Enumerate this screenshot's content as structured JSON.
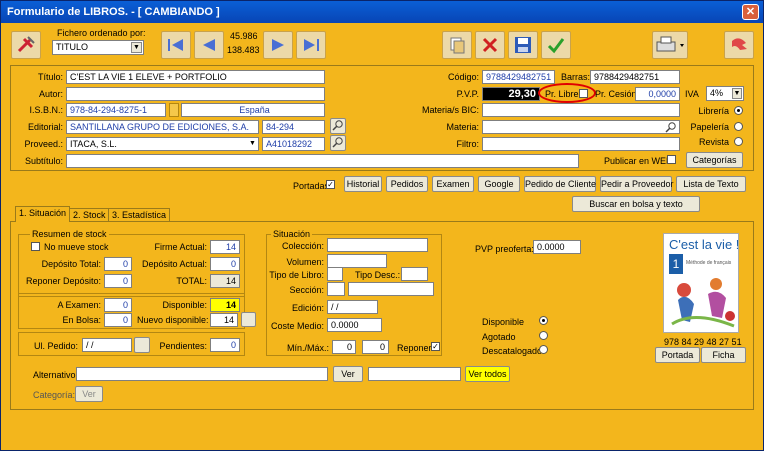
{
  "window": {
    "title": "Formulario de LIBROS. - [ CAMBIANDO ]",
    "close": "✕"
  },
  "toolbar": {
    "order_label": "Fichero ordenado por:",
    "order_value": "TITULO",
    "count_top": "45.986",
    "count_bottom": "138.483"
  },
  "book": {
    "titulo_label": "Título:",
    "titulo": "C'EST LA VIE 1 ELEVE + PORTFOLIO",
    "autor_label": "Autor:",
    "autor": "",
    "isbn_label": "I.S.B.N.:",
    "isbn": "978-84-294-8275-1",
    "pais": "España",
    "editorial_label": "Editorial:",
    "editorial": "SANTILLANA GRUPO DE EDICIONES, S.A.",
    "editorial_code": "84-294",
    "proveed_label": "Proveed.:",
    "proveed": "ITACA, S.L.",
    "proveed_code": "A41018292",
    "subtitulo_label": "Subtítulo:",
    "subtitulo": "",
    "codigo_label": "Código:",
    "codigo": "9788429482751",
    "barras_label": "Barras:",
    "barras": "9788429482751",
    "pvp_label": "P.V.P.",
    "pvp": "29,30",
    "pr_libre_label": "Pr. Libre",
    "pr_cesion_label": "Pr. Cesión",
    "pr_cesion": "0,0000",
    "iva_label": "IVA",
    "iva": "4%",
    "materia_bic_label": "Materia/s BIC:",
    "materia_label": "Materia:",
    "filtro_label": "Filtro:",
    "libreria_label": "Librería",
    "papeleria_label": "Papelería",
    "revista_label": "Revista",
    "publicar_web_label": "Publicar en WEB",
    "categorias_btn": "Categorías"
  },
  "actions": {
    "portadas_label": "Portadas",
    "buttons": [
      "Historial",
      "Pedidos",
      "Examen",
      "Google",
      "Pedido de Cliente",
      "Pedir a Proveedor",
      "Lista de Texto"
    ],
    "buscar_bolsa": "Buscar en bolsa y texto"
  },
  "tabs": [
    "1. Situación",
    "2. Stock",
    "3. Estadística"
  ],
  "stock": {
    "resumen_title": "Resumen de stock",
    "no_mueve_label": "No mueve stock",
    "firme_actual_label": "Firme Actual:",
    "firme_actual": "14",
    "deposito_total_label": "Depósito Total:",
    "deposito_total": "0",
    "deposito_actual_label": "Depósito Actual:",
    "deposito_actual": "0",
    "reponer_deposito_label": "Reponer Depósito:",
    "reponer_deposito": "0",
    "total_label": "TOTAL:",
    "total": "14",
    "a_examen_label": "A Examen:",
    "a_examen": "0",
    "disponible_label": "Disponible:",
    "disponible": "14",
    "en_bolsa_label": "En Bolsa:",
    "en_bolsa": "0",
    "nuevo_disponible_label": "Nuevo disponible:",
    "nuevo_disponible": "14",
    "ul_pedido_label": "Ul. Pedido:",
    "ul_pedido": "/ /",
    "pendientes_label": "Pendientes:",
    "pendientes": "0"
  },
  "situacion": {
    "title": "Situación",
    "coleccion_label": "Colección:",
    "volumen_label": "Volumen:",
    "tipo_libro_label": "Tipo de Libro:",
    "tipo_desc_label": "Tipo Desc.:",
    "seccion_label": "Sección:",
    "edicion_label": "Edición:",
    "edicion": "/ /",
    "coste_medio_label": "Coste Medio:",
    "coste_medio": "0.0000",
    "min_max_label": "Mín./Máx.:",
    "min": "0",
    "max": "0",
    "reponer_label": "Reponer"
  },
  "right": {
    "pvp_preoferta_label": "PVP preoferta:",
    "pvp_preoferta": "0.0000",
    "disponible_label": "Disponible",
    "agotado_label": "Agotado",
    "descatalogado_label": "Descatalogado",
    "cover_title": "C'est la vie !",
    "cover_subtitle": "Méthode de français",
    "barcode_text": "978 84 29 48 27 51",
    "portada_btn": "Portada",
    "ficha_btn": "Ficha"
  },
  "bottom": {
    "alternativo_label": "Alternativo:",
    "ver_btn": "Ver",
    "ver_todos_btn": "Ver todos",
    "categoria_label": "Categoría:",
    "ver2_btn": "Ver"
  }
}
